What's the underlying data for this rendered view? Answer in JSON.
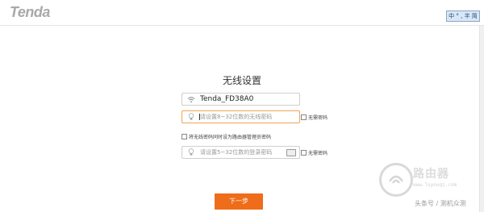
{
  "brand": {
    "logo_text": "Tenda"
  },
  "ime": {
    "label": "中 ° , 半 简"
  },
  "page": {
    "title": "无线设置"
  },
  "ssid": {
    "value": "Tenda_FD38A0",
    "icon": "wifi-icon"
  },
  "wifi_password": {
    "placeholder": "请设置8~32位数的无线密码",
    "icon": "bulb-icon"
  },
  "no_password_1": {
    "label": "无需密码"
  },
  "same_as_admin": {
    "label": "将无线密码同时设为路由器管理员密码"
  },
  "admin_password": {
    "placeholder": "请设置5~32位数的登录密码",
    "icon": "bulb-icon"
  },
  "no_password_2": {
    "label": "无需密码"
  },
  "next_button": {
    "label": "下一步"
  },
  "watermark": {
    "title": "路由器",
    "url": "www.luyouqi.com",
    "source": "头条号 / 测机众测"
  },
  "colors": {
    "accent": "#ef6c1a",
    "focus_border": "#f0a35a"
  }
}
